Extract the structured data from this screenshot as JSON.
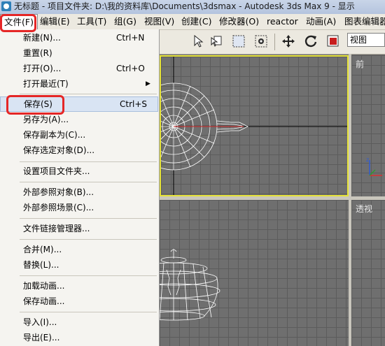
{
  "window": {
    "title_left": "无标题",
    "title_center": "项目文件夹: D:\\我的资料库\\Documents\\3dsmax",
    "title_app": "Autodesk 3ds Max 9",
    "title_right": "显示"
  },
  "menubar": {
    "file": "文件(F)",
    "edit": "编辑(E)",
    "tools": "工具(T)",
    "group": "组(G)",
    "views": "视图(V)",
    "create": "创建(C)",
    "modifiers": "修改器(O)",
    "reactor": "reactor",
    "animation": "动画(A)",
    "graph_editors": "图表编辑器"
  },
  "toolbar": {
    "view_select": "视图"
  },
  "file_menu": {
    "new": {
      "label": "新建(N)...",
      "shortcut": "Ctrl+N"
    },
    "reset": {
      "label": "重置(R)"
    },
    "open": {
      "label": "打开(O)...",
      "shortcut": "Ctrl+O"
    },
    "open_recent": {
      "label": "打开最近(T)"
    },
    "save": {
      "label": "保存(S)",
      "shortcut": "Ctrl+S"
    },
    "save_as": {
      "label": "另存为(A)..."
    },
    "save_copy_as": {
      "label": "保存副本为(C)..."
    },
    "save_selected": {
      "label": "保存选定对象(D)..."
    },
    "set_project_folder": {
      "label": "设置项目文件夹..."
    },
    "xref_objects": {
      "label": "外部参照对象(B)..."
    },
    "xref_scene": {
      "label": "外部参照场景(C)..."
    },
    "file_link_manager": {
      "label": "文件链接管理器..."
    },
    "merge": {
      "label": "合并(M)..."
    },
    "replace": {
      "label": "替换(L)..."
    },
    "load_animation": {
      "label": "加载动画..."
    },
    "save_animation": {
      "label": "保存动画..."
    },
    "import": {
      "label": "导入(I)..."
    },
    "export": {
      "label": "导出(E)..."
    }
  },
  "viewports": {
    "front": "前",
    "perspective": "透视"
  },
  "colors": {
    "highlight_red": "#e52626",
    "active_viewport_border": "#e6e33a"
  }
}
